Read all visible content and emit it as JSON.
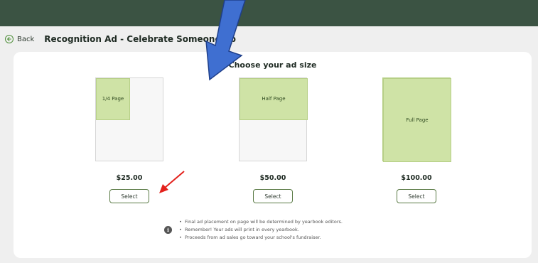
{
  "header": {
    "back_label": "Back",
    "title": "Recognition Ad - Celebrate Someone Sp"
  },
  "card": {
    "title": "Choose your ad size",
    "options": [
      {
        "label": "1/4 Page",
        "price": "$25.00",
        "select_label": "Select",
        "fill_fraction": 0.25
      },
      {
        "label": "Half Page",
        "price": "$50.00",
        "select_label": "Select",
        "fill_fraction": 0.5
      },
      {
        "label": "Full Page",
        "price": "$100.00",
        "select_label": "Select",
        "fill_fraction": 1.0
      }
    ],
    "info_items": [
      "Final ad placement on page will be determined by yearbook editors.",
      "Remember! Your ads will print in every yearbook.",
      "Proceeds from ad sales go toward your school's fundraiser."
    ]
  },
  "colors": {
    "topbar": "#3b5343",
    "ad_fill": "#cfe3a6",
    "button_border": "#5a7a45",
    "blue_arrow": "#3f6fd1",
    "red_arrow": "#e3211c"
  },
  "icons": {
    "back": "left-arrow-circle-icon",
    "info": "info-icon"
  }
}
